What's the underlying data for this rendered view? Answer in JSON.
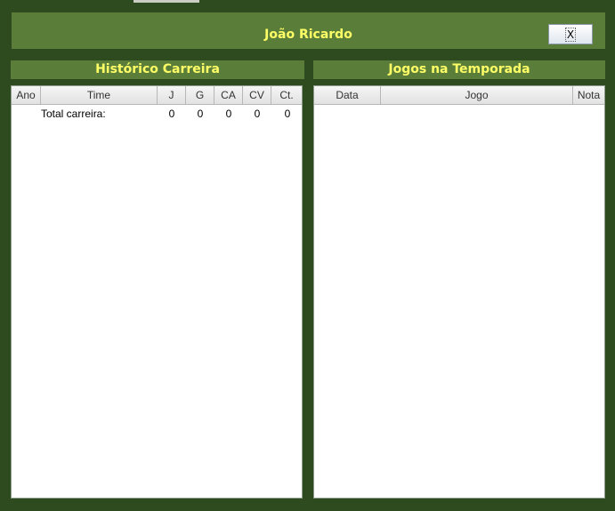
{
  "window": {
    "player_name": "João Ricardo",
    "close_label": "X"
  },
  "career": {
    "title": "Histórico Carreira",
    "columns": [
      "Ano",
      "Time",
      "J",
      "G",
      "CA",
      "CV",
      "Ct."
    ],
    "total_row": {
      "label": "Total carreira:",
      "j": "0",
      "g": "0",
      "ca": "0",
      "cv": "0",
      "ct": "0"
    }
  },
  "season": {
    "title": "Jogos na Temporada",
    "columns": [
      "Data",
      "Jogo",
      "Nota"
    ]
  },
  "colors": {
    "background": "#2e4a1f",
    "header_bar": "#5a7e3a",
    "title_text": "#ffff66"
  }
}
